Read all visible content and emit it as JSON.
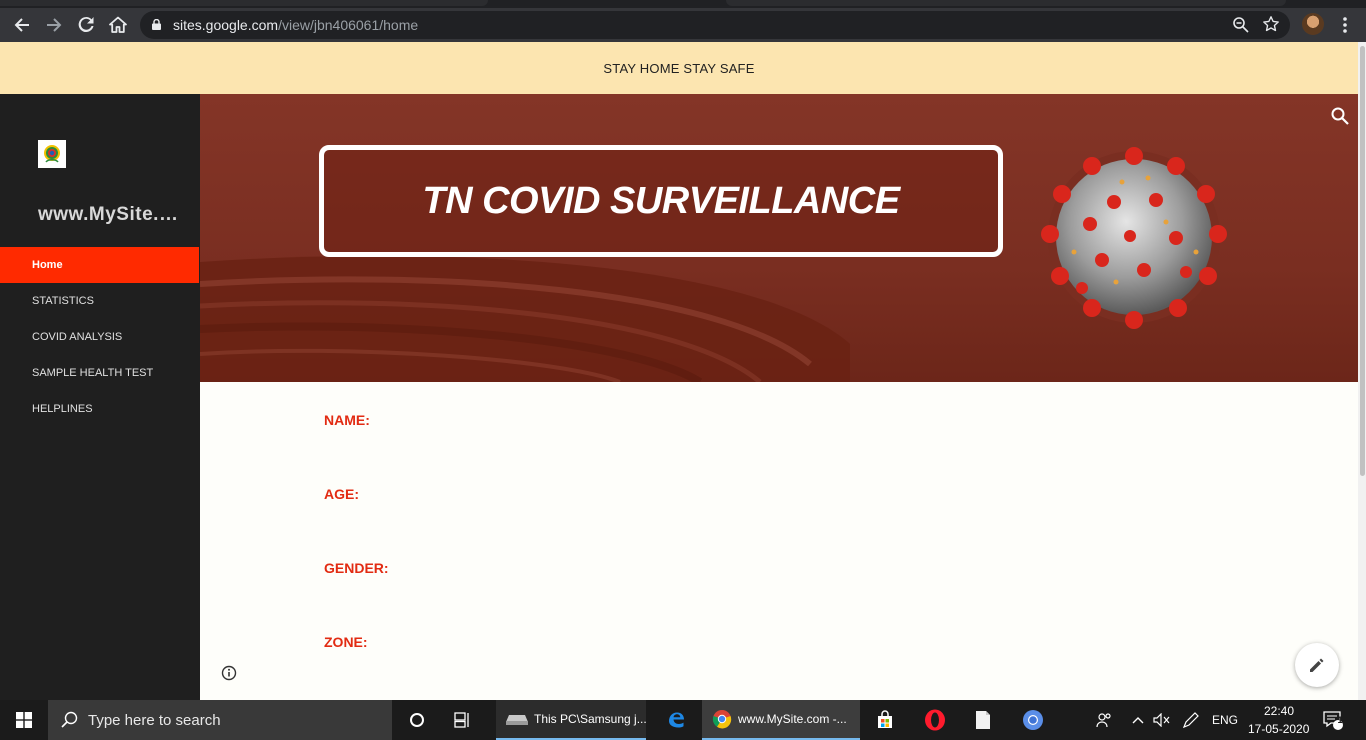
{
  "browser": {
    "url_host": "sites.google.com",
    "url_path": "/view/jbn406061/home"
  },
  "banner": {
    "text": "STAY HOME STAY SAFE"
  },
  "sidebar": {
    "site_title": "www.MySite.com",
    "items": [
      {
        "label": "Home",
        "active": true
      },
      {
        "label": "STATISTICS"
      },
      {
        "label": "COVID ANALYSIS"
      },
      {
        "label": "SAMPLE HEALTH TEST"
      },
      {
        "label": "HELPLINES"
      }
    ]
  },
  "hero": {
    "title": "TN COVID SURVEILLANCE"
  },
  "form": {
    "name_label": "NAME:",
    "age_label": "AGE:",
    "gender_label": "GENDER:",
    "zone_label": "ZONE:"
  },
  "taskbar": {
    "search_placeholder": "Type here to search",
    "explorer_label": "This PC\\Samsung j...",
    "chrome_label": "www.MySite.com -...",
    "language": "ENG",
    "time": "22:40",
    "date": "17-05-2020",
    "notification_count": "1"
  },
  "colors": {
    "banner_bg": "#fce5b0",
    "sidebar_bg": "#1f1f1f",
    "active_nav": "#ff2a00",
    "label_red": "#e22b12",
    "hero_bg": "#7a2e21"
  }
}
